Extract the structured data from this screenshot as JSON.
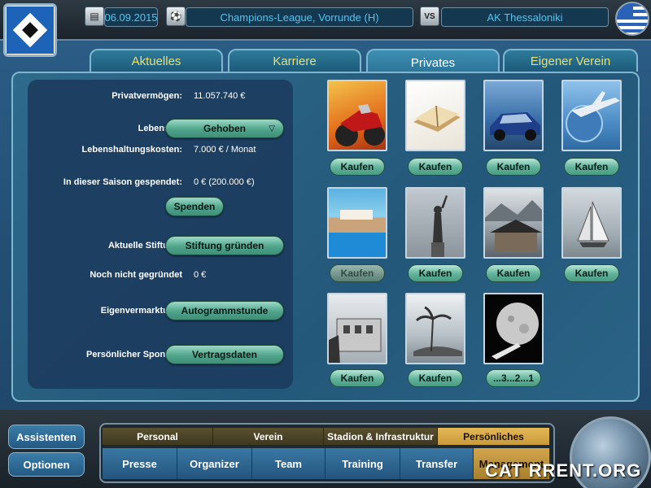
{
  "header": {
    "date": "06.09.2015",
    "competition": "Champions-League, Vorrunde (H)",
    "vs_label": "VS",
    "opponent": "AK Thessaloniki"
  },
  "tabs": [
    {
      "label": "Aktuelles"
    },
    {
      "label": "Karriere"
    },
    {
      "label": "Privates"
    },
    {
      "label": "Eigener Verein"
    }
  ],
  "private": {
    "wealth_label": "Privatvermögen:",
    "wealth_value": "11.057.740 €",
    "lifestyle_label": "Lebensstil",
    "lifestyle_value": "Gehoben",
    "living_cost_label": "Lebenshaltungskosten:",
    "living_cost_value": "7.000 € / Monat",
    "donated_label": "In dieser Saison gespendet:",
    "donated_value": "0 € (200.000 €)",
    "donate_button": "Spenden",
    "foundation_label": "Aktuelle Stiftung:",
    "foundation_button": "Stiftung gründen",
    "not_founded_label": "Noch nicht gegründet",
    "not_founded_value": "0 €",
    "self_marketing_label": "Eigenvermarktung:",
    "self_marketing_button": "Autogrammstunde",
    "sponsor_label": "Persönlicher Sponsor:",
    "sponsor_button": "Vertragsdaten"
  },
  "items": [
    {
      "name": "motorbike",
      "button": "Kaufen",
      "enabled": true
    },
    {
      "name": "book",
      "button": "Kaufen",
      "enabled": true
    },
    {
      "name": "car",
      "button": "Kaufen",
      "enabled": true
    },
    {
      "name": "airplane",
      "button": "Kaufen",
      "enabled": true
    },
    {
      "name": "pool-villa",
      "button": "Kaufen",
      "enabled": false
    },
    {
      "name": "statue-of-liberty",
      "button": "Kaufen",
      "enabled": true
    },
    {
      "name": "chalet",
      "button": "Kaufen",
      "enabled": true
    },
    {
      "name": "sailboat",
      "button": "Kaufen",
      "enabled": true
    },
    {
      "name": "mansion",
      "button": "Kaufen",
      "enabled": true
    },
    {
      "name": "island",
      "button": "Kaufen",
      "enabled": true
    },
    {
      "name": "space-shuttle",
      "button": "...3...2...1",
      "enabled": true
    }
  ],
  "sidebar": {
    "assistants": "Assistenten",
    "options": "Optionen"
  },
  "subtabs": [
    {
      "label": "Personal",
      "active": false
    },
    {
      "label": "Verein",
      "active": false
    },
    {
      "label": "Stadion & Infrastruktur",
      "active": false
    },
    {
      "label": "Persönliches",
      "active": true
    }
  ],
  "nav": [
    {
      "label": "Presse"
    },
    {
      "label": "Organizer"
    },
    {
      "label": "Team"
    },
    {
      "label": "Training"
    },
    {
      "label": "Transfer"
    },
    {
      "label": "Management"
    }
  ],
  "watermark": "CAT  RRENT.ORG",
  "colors": {
    "accent_tab_text": "#e8e070",
    "button_green": "#4fa58b",
    "active_subtab": "#c99a3a"
  }
}
